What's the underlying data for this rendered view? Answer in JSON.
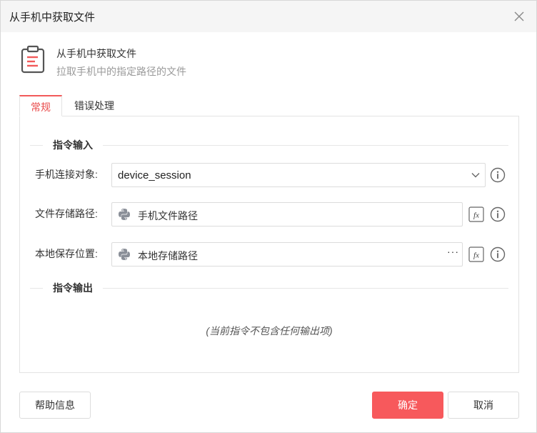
{
  "dialog": {
    "title": "从手机中获取文件",
    "close_icon": "close-icon"
  },
  "header": {
    "icon": "clipboard-icon",
    "title": "从手机中获取文件",
    "subtitle": "拉取手机中的指定路径的文件"
  },
  "tabs": [
    {
      "label": "常规",
      "active": true
    },
    {
      "label": "错误处理",
      "active": false
    }
  ],
  "input_section": {
    "title": "指令输入",
    "fields": [
      {
        "label": "手机连接对象:",
        "value": "device_session",
        "type": "select"
      },
      {
        "label": "文件存储路径:",
        "value": "手机文件路径",
        "type": "python-expression"
      },
      {
        "label": "本地保存位置:",
        "value": "本地存储路径",
        "type": "python-expression",
        "browse": "···"
      }
    ]
  },
  "output_section": {
    "title": "指令输出",
    "empty_text": "(当前指令不包含任何输出项)"
  },
  "footer": {
    "help": "帮助信息",
    "confirm": "确定",
    "cancel": "取消"
  },
  "colors": {
    "accent": "#f25a5a",
    "primary_button": "#f7595c",
    "python_icon": "#8a8f98"
  }
}
